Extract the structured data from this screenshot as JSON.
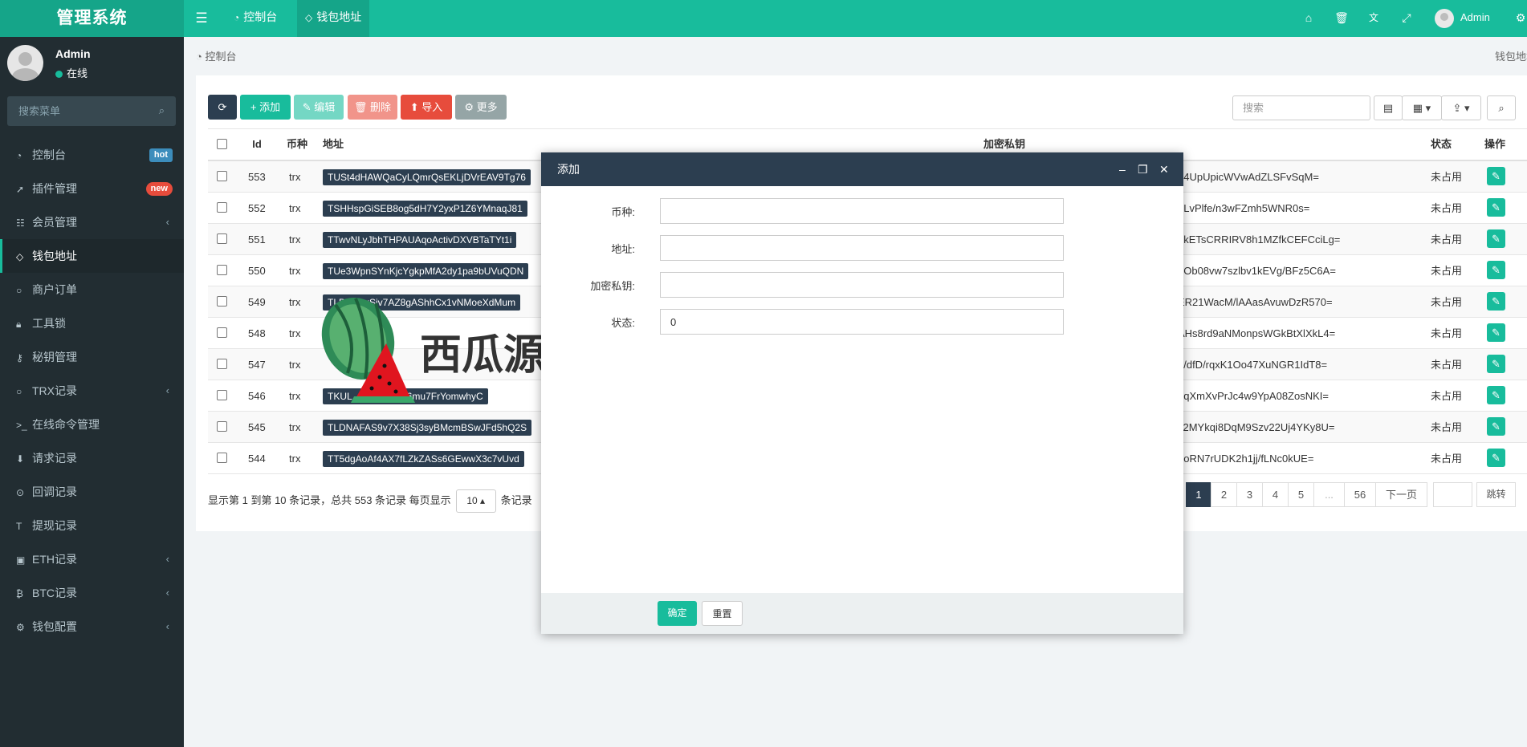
{
  "app": {
    "title": "管理系统"
  },
  "topbar": {
    "tabs": [
      {
        "label": "控制台"
      },
      {
        "label": "钱包地址"
      }
    ],
    "user": "Admin"
  },
  "sidebar": {
    "user": {
      "name": "Admin",
      "status": "在线"
    },
    "search_placeholder": "搜索菜单",
    "items": [
      {
        "label": "控制台",
        "icon": "dashboard-icon",
        "badge": "hot"
      },
      {
        "label": "插件管理",
        "icon": "rocket-icon",
        "badge": "new"
      },
      {
        "label": "会员管理",
        "icon": "list-icon"
      },
      {
        "label": "钱包地址",
        "icon": "diamond-icon"
      },
      {
        "label": "商户订单",
        "icon": "circle-icon"
      },
      {
        "label": "工具锁",
        "icon": "lock-icon"
      },
      {
        "label": "秘钥管理",
        "icon": "key-icon"
      },
      {
        "label": "TRX记录",
        "icon": "circle-icon"
      },
      {
        "label": "在线命令管理",
        "icon": "terminal-icon"
      },
      {
        "label": "请求记录",
        "icon": "download-icon"
      },
      {
        "label": "回调记录",
        "icon": "callback-icon"
      },
      {
        "label": "提现记录",
        "icon": "text-icon"
      },
      {
        "label": "ETH记录",
        "icon": "save-icon"
      },
      {
        "label": "BTC记录",
        "icon": "bitcoin-icon"
      },
      {
        "label": "钱包配置",
        "icon": "gear-icon"
      }
    ]
  },
  "breadcrumb": {
    "left": "控制台",
    "right": "钱包地址"
  },
  "toolbar": {
    "add": "添加",
    "edit": "编辑",
    "delete": "删除",
    "import": "导入",
    "more": "更多",
    "search_placeholder": "搜索"
  },
  "table": {
    "columns": {
      "id": "Id",
      "coin": "币种",
      "address": "地址",
      "key": "加密私钥",
      "status": "状态",
      "action": "操作"
    },
    "rows": [
      {
        "id": "553",
        "coin": "trx",
        "address": "TUSt4dHAWQaCyLQmrQsEKLjDVrEAV9Tg76",
        "key": "84UpUpicWVwAdZLSFvSqM=",
        "status": "未占用"
      },
      {
        "id": "552",
        "coin": "trx",
        "address": "TSHHspGiSEB8og5dH7Y2yxP1Z6YMnaqJ81",
        "key": "LLvPlfe/n3wFZmh5WNR0s=",
        "status": "未占用"
      },
      {
        "id": "551",
        "coin": "trx",
        "address": "TTwvNLyJbhTHPAUAqoActivDXVBTaTYt1i",
        "key": "nkETsCRRIRV8h1MZfkCEFCciLg=",
        "status": "未占用"
      },
      {
        "id": "550",
        "coin": "trx",
        "address": "TUe3WpnSYnKjcYgkpMfA2dy1pa9bUVuQDN",
        "key": "2Ob08vw7szlbv1kEVg/BFz5C6A=",
        "status": "未占用"
      },
      {
        "id": "549",
        "coin": "trx",
        "address": "TLBxxxxxSiv7AZ8gAShhCx1vNMoeXdMum",
        "key": "ER21WacM/lAAasAvuwDzR570=",
        "status": "未占用"
      },
      {
        "id": "548",
        "coin": "trx",
        "address": "",
        "key": "AHs8rd9aNMonpsWGkBtXlXkL4=",
        "status": "未占用"
      },
      {
        "id": "547",
        "coin": "trx",
        "address": "",
        "key": "0/dfD/rqxK1Oo47XuNGR1IdT8=",
        "status": "未占用"
      },
      {
        "id": "546",
        "coin": "trx",
        "address": "TKUL...8gY48gmp6mu7FrYomwhyC",
        "key": "oqXmXvPrJc4w9YpA08ZosNKI=",
        "status": "未占用"
      },
      {
        "id": "545",
        "coin": "trx",
        "address": "TLDNAFAS9v7X38Sj3syBMcmBSwJFd5hQ2S",
        "key": "y2MYkqi8DqM9Szv22Uj4YKy8U=",
        "status": "未占用"
      },
      {
        "id": "544",
        "coin": "trx",
        "address": "TT5dgAoAf4AX7fLZkZASs6GEwwX3c7vUvd",
        "key": "3oRN7rUDK2h1jj/fLNc0kUE=",
        "status": "未占用"
      }
    ]
  },
  "pagination": {
    "info_prefix": "显示第 1 到第 10 条记录，总共 553 条记录 每页显示",
    "page_size": "10",
    "info_suffix": "条记录",
    "pages": [
      "1",
      "2",
      "3",
      "4",
      "5",
      "...",
      "56"
    ],
    "next": "下一页",
    "jump": "跳转"
  },
  "modal": {
    "title": "添加",
    "fields": [
      {
        "label": "币种:",
        "value": ""
      },
      {
        "label": "地址:",
        "value": ""
      },
      {
        "label": "加密私钥:",
        "value": ""
      },
      {
        "label": "状态:",
        "value": "0"
      }
    ],
    "confirm": "确定",
    "reset": "重置"
  },
  "watermark": {
    "text": "西瓜源码"
  },
  "colors": {
    "primary": "#18bc9c",
    "dark": "#2c3e50",
    "sidebar": "#222d32",
    "danger": "#e74c3c",
    "muted": "#95a5a6"
  }
}
